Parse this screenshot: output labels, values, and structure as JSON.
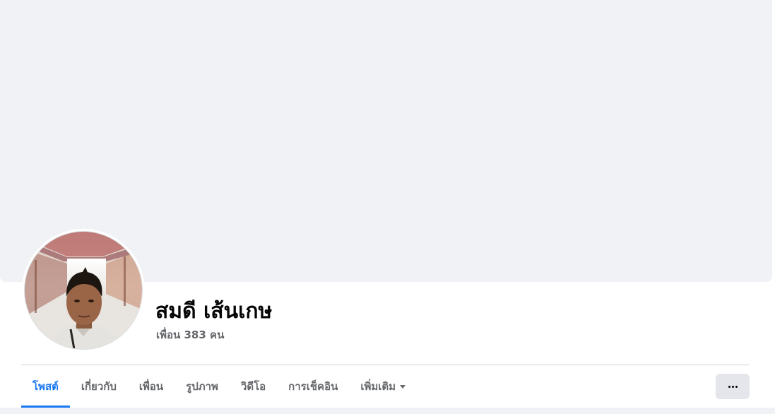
{
  "profile": {
    "name": "สมดี เส้นเกษ",
    "friends_text": "เพื่อน 383 คน"
  },
  "tabs": [
    {
      "label": "โพสต์",
      "active": true
    },
    {
      "label": "เกี่ยวกับ",
      "active": false
    },
    {
      "label": "เพื่อน",
      "active": false
    },
    {
      "label": "รูปภาพ",
      "active": false
    },
    {
      "label": "วิดีโอ",
      "active": false
    },
    {
      "label": "การเช็คอิน",
      "active": false
    },
    {
      "label": "เพิ่มเติม",
      "active": false,
      "dropdown": true
    }
  ],
  "icons": {
    "more_options": "ellipsis-icon",
    "dropdown": "caret-down-icon"
  },
  "colors": {
    "accent": "#1877f2",
    "cover_bg": "#f0f2f5",
    "secondary_text": "#65676b"
  }
}
